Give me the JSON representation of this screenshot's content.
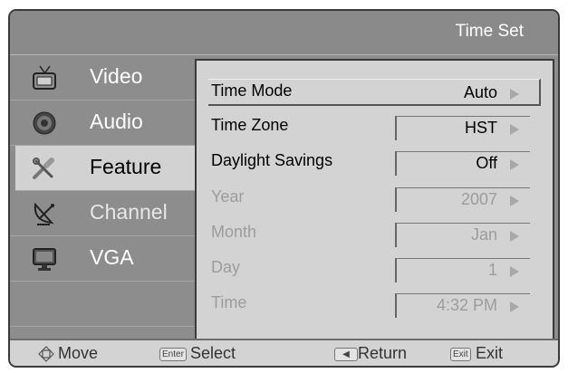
{
  "header": {
    "title": "Time Set"
  },
  "sidebar": {
    "items": [
      {
        "label": "Video",
        "icon": "tv-icon"
      },
      {
        "label": "Audio",
        "icon": "speaker-icon"
      },
      {
        "label": "Feature",
        "icon": "tools-icon"
      },
      {
        "label": "Channel",
        "icon": "satellite-dish-icon"
      },
      {
        "label": "VGA",
        "icon": "monitor-icon"
      }
    ],
    "active": "Feature"
  },
  "settings": {
    "rows": [
      {
        "label": "Time Mode",
        "value": "Auto"
      },
      {
        "label": "Time Zone",
        "value": "HST"
      },
      {
        "label": "Daylight Savings",
        "value": "Off"
      },
      {
        "label": "Year",
        "value": "2007"
      },
      {
        "label": "Month",
        "value": "Jan"
      },
      {
        "label": "Day",
        "value": "1"
      },
      {
        "label": "Time",
        "value": "4:32 PM"
      }
    ]
  },
  "footer": {
    "move": "Move",
    "enter_key": "Enter",
    "select": "Select",
    "return": "Return",
    "exit_key": "Exit",
    "exit": "Exit"
  },
  "colors": {
    "frame": "#8d8d8d",
    "panel": "#d3d3d3",
    "active_item": "#d2d2d2"
  }
}
